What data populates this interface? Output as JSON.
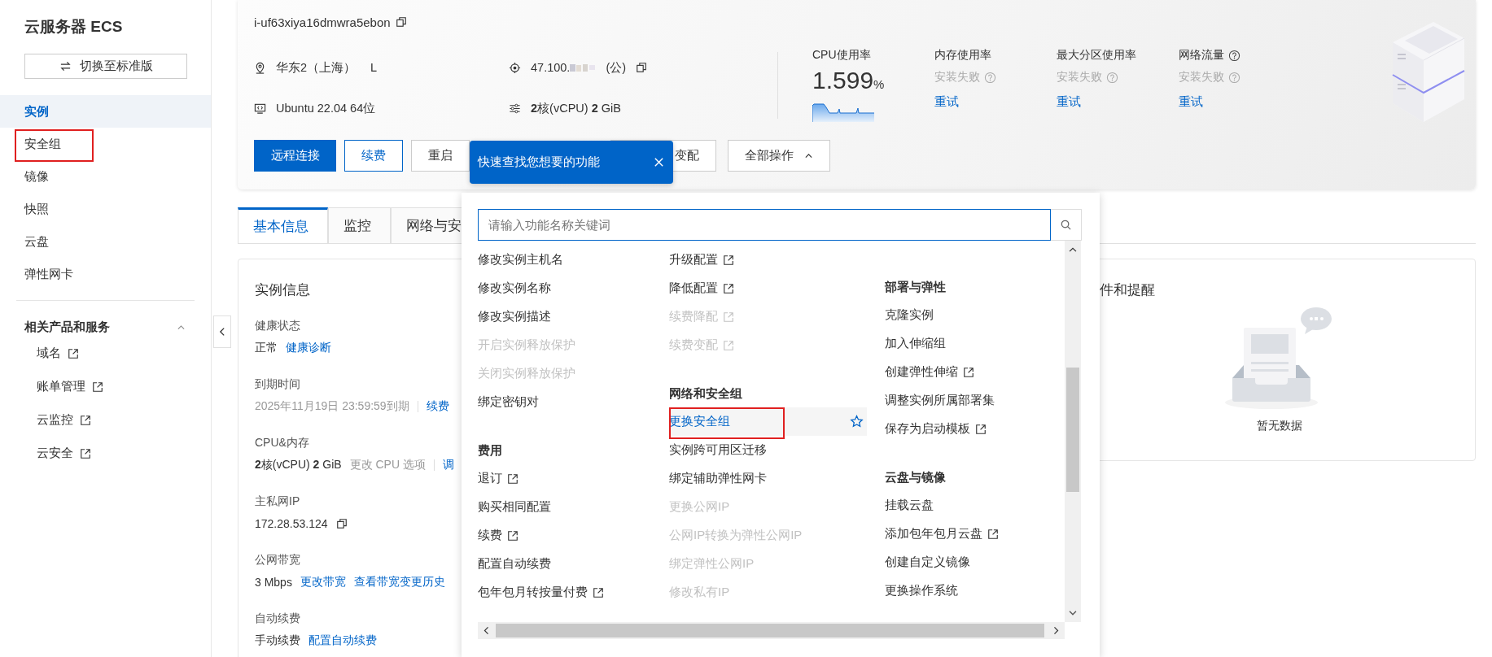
{
  "sidebar": {
    "title": "云服务器 ECS",
    "switch_button": "切换至标准版",
    "nav": [
      {
        "label": "实例",
        "selected": true,
        "marked": false
      },
      {
        "label": "安全组",
        "selected": false,
        "marked": true
      },
      {
        "label": "镜像",
        "selected": false,
        "marked": false
      },
      {
        "label": "快照",
        "selected": false,
        "marked": false
      },
      {
        "label": "云盘",
        "selected": false,
        "marked": false
      },
      {
        "label": "弹性网卡",
        "selected": false,
        "marked": false
      }
    ],
    "related": {
      "title": "相关产品和服务",
      "expanded": true,
      "items": [
        "域名",
        "账单管理",
        "云监控",
        "云安全"
      ]
    }
  },
  "instance": {
    "id": "i-uf63xiya16dmwra5ebon",
    "region": "华东2（上海）",
    "zone": "L",
    "ip": "47.100.",
    "ip_type": "(公)",
    "os": "Ubuntu 22.04 64位",
    "spec": "**2**核(vCPU) **2** GiB"
  },
  "metrics": [
    {
      "label": "CPU使用率",
      "kind": "chart",
      "value": "1.599",
      "unit": "%"
    },
    {
      "label": "内存使用率",
      "kind": "failed",
      "status": "安装失败",
      "action": "重试"
    },
    {
      "label": "最大分区使用率",
      "kind": "failed",
      "status": "安装失败",
      "action": "重试"
    },
    {
      "label": "网络流量",
      "kind": "failed",
      "help": true,
      "status": "安装失败",
      "action": "重试"
    }
  ],
  "actions": [
    {
      "label": "远程连接",
      "kind": "primary"
    },
    {
      "label": "续费",
      "kind": "outline"
    },
    {
      "label": "重启",
      "kind": "default"
    },
    {
      "label": "变配",
      "kind": "partial"
    }
  ],
  "all_actions": {
    "label": "全部操作",
    "expanded": true
  },
  "tooltip": {
    "text": "快速查找您想要的功能"
  },
  "tabs": [
    {
      "label": "基本信息",
      "selected": true
    },
    {
      "label": "监控",
      "selected": false
    },
    {
      "label": "网络与安",
      "selected": false
    }
  ],
  "instance_info": {
    "title": "实例信息",
    "fields": [
      {
        "label": "健康状态",
        "values": [
          {
            "text": "正常",
            "kind": "plain"
          },
          {
            "text": "健康诊断",
            "kind": "link"
          }
        ]
      },
      {
        "label": "到期时间",
        "values": [
          {
            "text": "2025年11月19日 23:59:59到期",
            "kind": "muted"
          },
          {
            "text": "续费",
            "kind": "link"
          }
        ]
      },
      {
        "label": "CPU&内存",
        "values": [
          {
            "text": "**2**核(vCPU) **2** GiB",
            "kind": "plain"
          },
          {
            "text": "更改 CPU 选项",
            "kind": "muted"
          },
          {
            "text": "调",
            "kind": "link"
          }
        ]
      },
      {
        "label": "主私网IP",
        "copy": true,
        "values": [
          {
            "text": "172.28.53.124",
            "kind": "plain"
          }
        ]
      },
      {
        "label": "公网带宽",
        "values": [
          {
            "text": "3 Mbps",
            "kind": "plain"
          },
          {
            "text": "更改带宽",
            "kind": "link"
          },
          {
            "text": "查看带宽变更历史",
            "kind": "link"
          }
        ]
      },
      {
        "label": "自动续费",
        "values": [
          {
            "text": "手动续费",
            "kind": "plain"
          },
          {
            "text": "配置自动续费",
            "kind": "link"
          }
        ]
      }
    ]
  },
  "events": {
    "title": "件和提醒",
    "empty_text": "暂无数据"
  },
  "quick_menu": {
    "search_placeholder": "请输入功能名称关键词",
    "columns": [
      [
        {
          "items": [
            {
              "label": "修改实例主机名",
              "disabled": false,
              "external": false,
              "highlighted": false,
              "marked": false
            },
            {
              "label": "修改实例名称",
              "disabled": false,
              "external": false,
              "highlighted": false,
              "marked": false
            },
            {
              "label": "修改实例描述",
              "disabled": false,
              "external": false,
              "highlighted": false,
              "marked": false
            },
            {
              "label": "开启实例释放保护",
              "disabled": true,
              "external": false,
              "highlighted": false,
              "marked": false
            },
            {
              "label": "关闭实例释放保护",
              "disabled": true,
              "external": false,
              "highlighted": false,
              "marked": false
            },
            {
              "label": "绑定密钥对",
              "disabled": false,
              "external": false,
              "highlighted": false,
              "marked": false
            }
          ]
        },
        {
          "heading": "费用",
          "items": [
            {
              "label": "退订",
              "disabled": false,
              "external": true,
              "highlighted": false,
              "marked": false
            },
            {
              "label": "购买相同配置",
              "disabled": false,
              "external": false,
              "highlighted": false,
              "marked": false
            },
            {
              "label": "续费",
              "disabled": false,
              "external": true,
              "highlighted": false,
              "marked": false
            },
            {
              "label": "配置自动续费",
              "disabled": false,
              "external": false,
              "highlighted": false,
              "marked": false
            },
            {
              "label": "包年包月转按量付费",
              "disabled": false,
              "external": true,
              "highlighted": false,
              "marked": false
            }
          ]
        }
      ],
      [
        {
          "items": [
            {
              "label": "升级配置",
              "disabled": false,
              "external": true,
              "highlighted": false,
              "marked": false
            },
            {
              "label": "降低配置",
              "disabled": false,
              "external": true,
              "highlighted": false,
              "marked": false
            },
            {
              "label": "续费降配",
              "disabled": true,
              "external": true,
              "highlighted": false,
              "marked": false
            },
            {
              "label": "续费变配",
              "disabled": true,
              "external": true,
              "highlighted": false,
              "marked": false
            }
          ]
        },
        {
          "heading": "网络和安全组",
          "items": [
            {
              "label": "更换安全组",
              "disabled": false,
              "external": false,
              "highlighted": true,
              "marked": true
            },
            {
              "label": "实例跨可用区迁移",
              "disabled": false,
              "external": false,
              "highlighted": false,
              "marked": false
            },
            {
              "label": "绑定辅助弹性网卡",
              "disabled": false,
              "external": false,
              "highlighted": false,
              "marked": false
            },
            {
              "label": "更换公网IP",
              "disabled": true,
              "external": false,
              "highlighted": false,
              "marked": false
            },
            {
              "label": "公网IP转换为弹性公网IP",
              "disabled": true,
              "external": false,
              "highlighted": false,
              "marked": false
            },
            {
              "label": "绑定弹性公网IP",
              "disabled": true,
              "external": false,
              "highlighted": false,
              "marked": false
            },
            {
              "label": "修改私有IP",
              "disabled": true,
              "external": false,
              "highlighted": false,
              "marked": false
            }
          ]
        }
      ],
      [
        {
          "heading": "部署与弹性",
          "items": [
            {
              "label": "克隆实例",
              "disabled": false,
              "external": false,
              "highlighted": false,
              "marked": false
            },
            {
              "label": "加入伸缩组",
              "disabled": false,
              "external": false,
              "highlighted": false,
              "marked": false
            },
            {
              "label": "创建弹性伸缩",
              "disabled": false,
              "external": true,
              "highlighted": false,
              "marked": false
            },
            {
              "label": "调整实例所属部署集",
              "disabled": false,
              "external": false,
              "highlighted": false,
              "marked": false
            },
            {
              "label": "保存为启动模板",
              "disabled": false,
              "external": true,
              "highlighted": false,
              "marked": false
            }
          ]
        },
        {
          "heading": "云盘与镜像",
          "items": [
            {
              "label": "挂载云盘",
              "disabled": false,
              "external": false,
              "highlighted": false,
              "marked": false
            },
            {
              "label": "添加包年包月云盘",
              "disabled": false,
              "external": true,
              "highlighted": false,
              "marked": false
            },
            {
              "label": "创建自定义镜像",
              "disabled": false,
              "external": false,
              "highlighted": false,
              "marked": false
            },
            {
              "label": "更换操作系统",
              "disabled": false,
              "external": false,
              "highlighted": false,
              "marked": false
            }
          ]
        }
      ]
    ]
  }
}
